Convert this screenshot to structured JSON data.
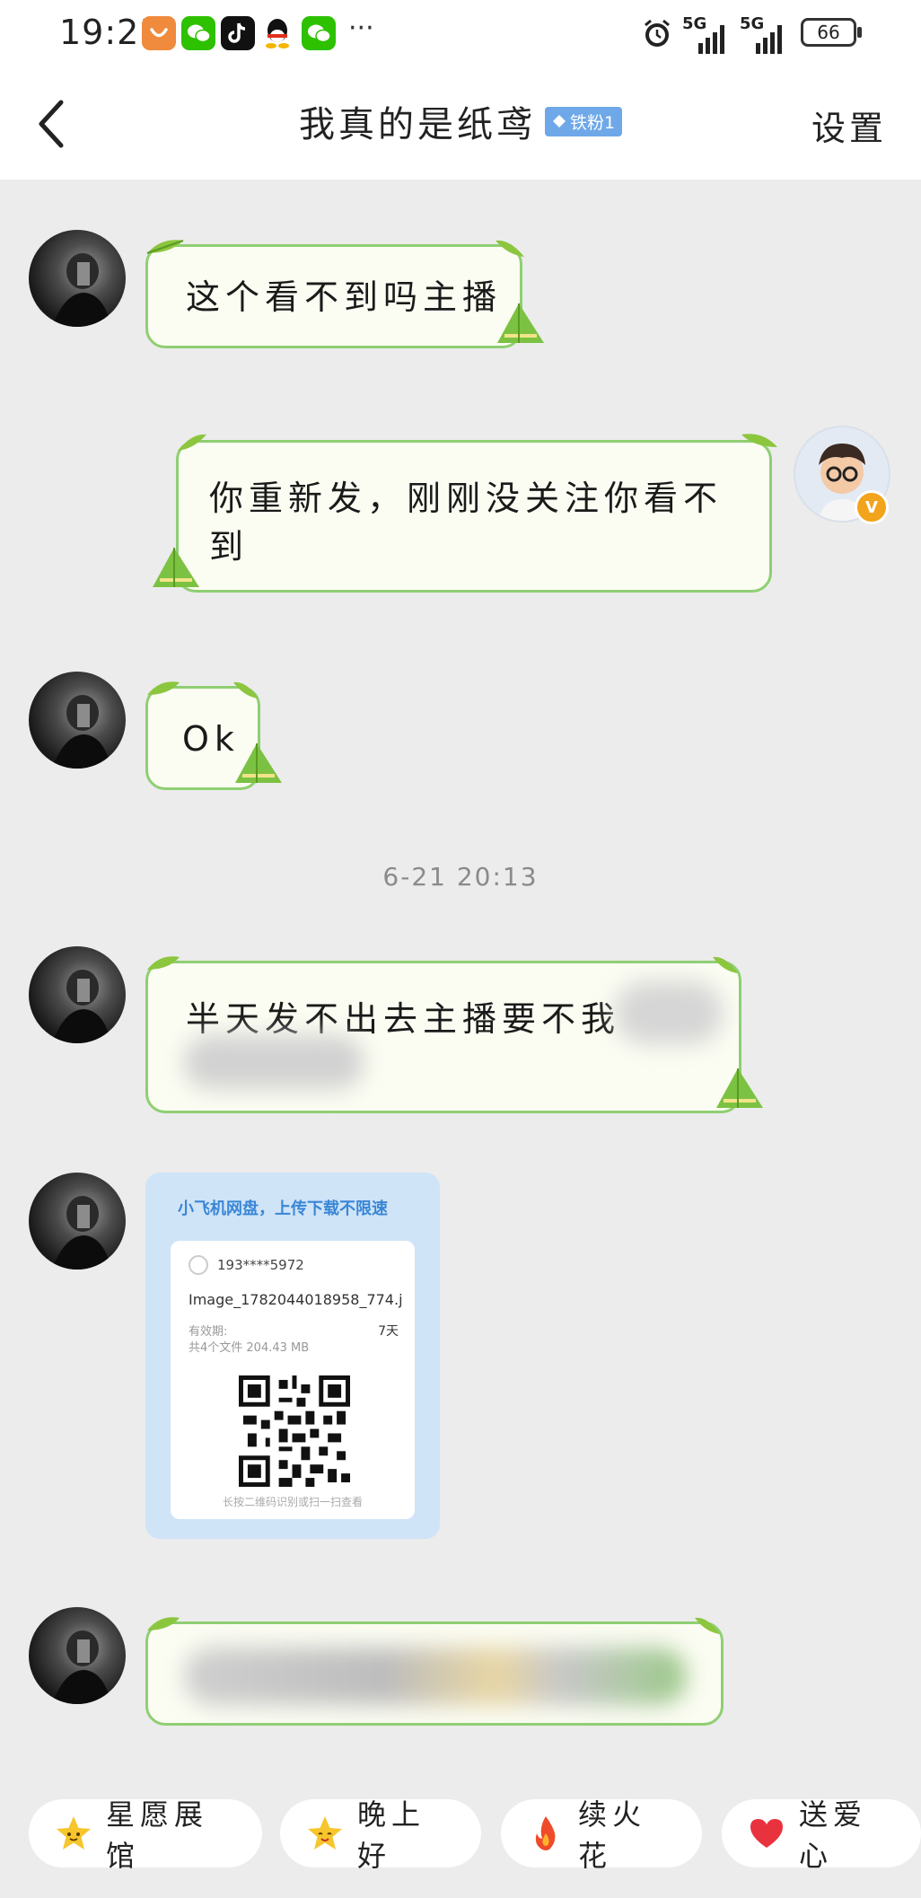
{
  "status_bar": {
    "time": "19:25",
    "more": "···",
    "signal_1": "5G",
    "signal_2": "5G",
    "battery": "66"
  },
  "header": {
    "title": "我真的是纸鸢",
    "fan_badge": "铁粉1",
    "settings": "设置"
  },
  "messages": {
    "m1": "这个看不到吗主播",
    "m2_line1": "你重新发，刚刚没关注你看不",
    "m2_line2": "到",
    "m3": "Ok",
    "timestamp": "6-21 20:13",
    "m4": "半天发不出去主播要不我"
  },
  "file_card": {
    "title": "小飞机网盘，上传下载不限速",
    "sender": "193****5972",
    "file_name": "Image_1782044018958_774.j···",
    "validity_label": "有效期:",
    "validity_value": "7天",
    "summary": "共4个文件  204.43 MB",
    "hint": "长按二维码识别或扫一扫查看"
  },
  "quick_replies": {
    "r1": "星愿展馆",
    "r2": "晚上好",
    "r3": "续火花",
    "r4": "送爱心"
  },
  "colors": {
    "bubble_border": "#8fcf73",
    "bubble_fill": "#fbfcf2",
    "leaf": "#8cc63f",
    "badge": "#6fa8e8",
    "verified": "#f2a41c"
  }
}
